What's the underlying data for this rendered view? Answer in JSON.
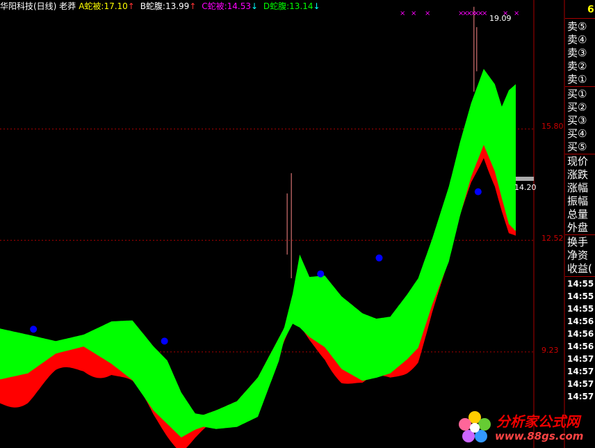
{
  "header": {
    "title": "华阳科技(日线) 老莽",
    "a_label": "A蛇被:17.10",
    "a_arrow": "↑",
    "b_label": "B蛇腹:13.99",
    "b_arrow": "↑",
    "c_label": "C蛇被:14.53",
    "c_arrow": "↓",
    "d_label": "D蛇腹:13.14",
    "d_arrow": "↓",
    "corner_value": "6"
  },
  "colors": {
    "background": "#000000",
    "upper_band": "#00ff00",
    "lower_band": "#ff0000",
    "grid": "#aa0000",
    "marker": "#0000ff",
    "cross": "#ff00ff",
    "title": "#ffffff",
    "a_color": "#ffff00",
    "b_color": "#ffffff",
    "c_color": "#ff00ff",
    "d_color": "#00ff00"
  },
  "side_panel": {
    "sell": [
      "卖⑤",
      "卖④",
      "卖③",
      "卖②",
      "卖①"
    ],
    "buy": [
      "买①",
      "买②",
      "买③",
      "买④",
      "买⑤"
    ],
    "stats1": [
      "现价",
      "涨跌",
      "涨幅",
      "振幅",
      "总量",
      "外盘"
    ],
    "stats2": [
      "换手",
      "净资",
      "收益("
    ],
    "times": [
      "14:55",
      "14:55",
      "14:55",
      "14:56",
      "14:56",
      "14:56",
      "14:57",
      "14:57",
      "14:57",
      "14:57"
    ]
  },
  "price_labels": {
    "high_label": "19.09",
    "current_label": "14.20"
  },
  "logo": {
    "name": "分析家公式网",
    "url": "www.88gs.com"
  },
  "chart_data": {
    "type": "area",
    "y_axis": {
      "ticks": [
        15.8,
        12.52,
        9.23
      ],
      "tick_labels": [
        "15.80",
        "12.52",
        "9.23"
      ],
      "ylim": [
        6.4,
        19.6
      ],
      "grid": "dotted"
    },
    "x": [
      0,
      1,
      2,
      3,
      4,
      5,
      6,
      7,
      8,
      9,
      10,
      11,
      12,
      13,
      14,
      15,
      16,
      17,
      18,
      19,
      20,
      21,
      22,
      23,
      24,
      25,
      26,
      27,
      28,
      29,
      30,
      31,
      32,
      33,
      34,
      35,
      36,
      37,
      38,
      39,
      40,
      41,
      42,
      43,
      44,
      45,
      46,
      47,
      48,
      49,
      50,
      51,
      52,
      53,
      54,
      55,
      56,
      57,
      58,
      59,
      60,
      61,
      62,
      63,
      64,
      65,
      66,
      67,
      68,
      69,
      70,
      71,
      72,
      73,
      74,
      75,
      76,
      77,
      78,
      79,
      80,
      81,
      82,
      83,
      84,
      85,
      86,
      87,
      88,
      89,
      90,
      91,
      92,
      93,
      94,
      95,
      96,
      97,
      98,
      99,
      100,
      101,
      102,
      103,
      104,
      105,
      106,
      107,
      108,
      109,
      110,
      111,
      112,
      113,
      114,
      115,
      116,
      117,
      118,
      119,
      120,
      121,
      122,
      123,
      124,
      125,
      126,
      127,
      128,
      129,
      130,
      131,
      132,
      133,
      134,
      135,
      136,
      137,
      138,
      139,
      140,
      141,
      142,
      143,
      144,
      145,
      146,
      147,
      148,
      149,
      150,
      151,
      152,
      153,
      154,
      155,
      156,
      157,
      158,
      159,
      160,
      161,
      162,
      163,
      164,
      165,
      166,
      167,
      168,
      169,
      170,
      171,
      172,
      173,
      174,
      175,
      176,
      177,
      178,
      179,
      180,
      181,
      182,
      183,
      184,
      185,
      186,
      187,
      188,
      189,
      190,
      191,
      192,
      193,
      194,
      195,
      196,
      197,
      198,
      199,
      200,
      201,
      202,
      203,
      204,
      205,
      206,
      207,
      208,
      209,
      210,
      211,
      212,
      213,
      214,
      215,
      216,
      217,
      218,
      219,
      220,
      221,
      222,
      223,
      224,
      225,
      226,
      227,
      228,
      229,
      230,
      231,
      232,
      233,
      234,
      235,
      236,
      237,
      238,
      239,
      240,
      241,
      242,
      243,
      244,
      245,
      246,
      247,
      248,
      249,
      250,
      251,
      252,
      253,
      254,
      255,
      256,
      257,
      258,
      259,
      260,
      261,
      262,
      263,
      264,
      265,
      266,
      267,
      268,
      269,
      270,
      271,
      272,
      273,
      274,
      275,
      276,
      277,
      278,
      279,
      280,
      281,
      282,
      283,
      284,
      285,
      286,
      287,
      288,
      289,
      290,
      291,
      292,
      293,
      294,
      295,
      296,
      297,
      298,
      299,
      300,
      301,
      302,
      303,
      304,
      305,
      306,
      307,
      308,
      309,
      310,
      311,
      312,
      313,
      314,
      315,
      316,
      317,
      318,
      319,
      320,
      321,
      322,
      323,
      324,
      325,
      326,
      327,
      328,
      329,
      330,
      331,
      332,
      333,
      334,
      335,
      336,
      337,
      338,
      339,
      340,
      341,
      342,
      343,
      344,
      345,
      346,
      347,
      348,
      349,
      350,
      351,
      352,
      353,
      354,
      355,
      356,
      357,
      358,
      359,
      360,
      361,
      362,
      363,
      364,
      365,
      366,
      367,
      368,
      369,
      370
    ],
    "series": [
      {
        "name": "A",
        "keypoints": [
          [
            0,
            9.92
          ],
          [
            20,
            9.74
          ],
          [
            40,
            9.55
          ],
          [
            60,
            9.74
          ],
          [
            80,
            10.13
          ],
          [
            95,
            10.16
          ],
          [
            110,
            9.4
          ],
          [
            120,
            8.98
          ],
          [
            130,
            8.04
          ],
          [
            140,
            7.42
          ],
          [
            155,
            7.31
          ],
          [
            170,
            7.37
          ],
          [
            185,
            7.67
          ],
          [
            200,
            9.31
          ],
          [
            210,
            10.95
          ],
          [
            215,
            12.1
          ],
          [
            222,
            11.44
          ],
          [
            233,
            11.48
          ],
          [
            245,
            10.87
          ],
          [
            260,
            10.37
          ],
          [
            270,
            10.21
          ],
          [
            280,
            10.27
          ],
          [
            292,
            10.92
          ],
          [
            300,
            11.4
          ],
          [
            310,
            12.56
          ],
          [
            322,
            14.1
          ],
          [
            330,
            15.41
          ],
          [
            338,
            16.56
          ],
          [
            347,
            17.57
          ],
          [
            355,
            17.12
          ],
          [
            360,
            16.46
          ],
          [
            365,
            16.94
          ],
          [
            370,
            17.12
          ]
        ]
      },
      {
        "name": "B",
        "keypoints": [
          [
            0,
            8.77
          ],
          [
            20,
            8.95
          ],
          [
            40,
            9.53
          ],
          [
            60,
            9.74
          ],
          [
            80,
            9.23
          ],
          [
            95,
            8.75
          ],
          [
            110,
            7.86
          ],
          [
            120,
            7.46
          ],
          [
            130,
            7.06
          ],
          [
            140,
            7.29
          ],
          [
            155,
            7.51
          ],
          [
            170,
            7.78
          ],
          [
            185,
            8.48
          ],
          [
            200,
            9.64
          ],
          [
            210,
            10.41
          ],
          [
            215,
            10.3
          ],
          [
            222,
            10.02
          ],
          [
            233,
            9.72
          ],
          [
            245,
            9.08
          ],
          [
            260,
            8.73
          ],
          [
            270,
            8.82
          ],
          [
            280,
            8.95
          ],
          [
            292,
            9.36
          ],
          [
            300,
            9.7
          ],
          [
            310,
            10.97
          ],
          [
            322,
            12.24
          ],
          [
            330,
            13.59
          ],
          [
            338,
            14.74
          ],
          [
            347,
            15.68
          ],
          [
            355,
            14.9
          ],
          [
            360,
            14.11
          ],
          [
            365,
            13.35
          ],
          [
            370,
            13.14
          ]
        ]
      },
      {
        "name": "C",
        "keypoints": [
          [
            0,
            8.27
          ],
          [
            20,
            8.47
          ],
          [
            40,
            9.01
          ],
          [
            60,
            9.3
          ],
          [
            80,
            9.23
          ],
          [
            95,
            8.71
          ],
          [
            110,
            7.86
          ],
          [
            120,
            7.46
          ],
          [
            130,
            7.06
          ],
          [
            140,
            7.29
          ],
          [
            155,
            7.51
          ],
          [
            170,
            7.78
          ],
          [
            185,
            8.48
          ],
          [
            200,
            9.64
          ],
          [
            210,
            10.41
          ],
          [
            215,
            10.3
          ],
          [
            222,
            10.02
          ],
          [
            233,
            9.72
          ],
          [
            245,
            9.08
          ],
          [
            260,
            8.73
          ],
          [
            270,
            8.82
          ],
          [
            280,
            8.95
          ],
          [
            292,
            9.36
          ],
          [
            300,
            9.7
          ],
          [
            310,
            10.97
          ],
          [
            322,
            12.24
          ],
          [
            330,
            13.59
          ],
          [
            338,
            14.74
          ],
          [
            347,
            15.68
          ],
          [
            355,
            14.9
          ],
          [
            360,
            14.11
          ],
          [
            365,
            13.35
          ],
          [
            370,
            13.14
          ]
        ]
      }
    ],
    "markers": [
      {
        "series": "blue-dot",
        "points": [
          [
            24,
            9.9
          ],
          [
            118,
            9.55
          ],
          [
            230,
            11.53
          ],
          [
            272,
            12.0
          ],
          [
            343,
            13.95
          ]
        ]
      }
    ]
  }
}
